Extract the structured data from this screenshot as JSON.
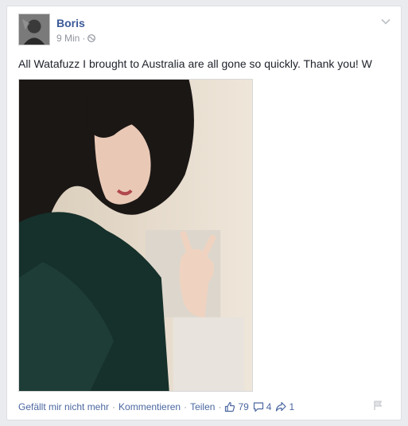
{
  "post": {
    "author": "Boris",
    "time": "9 Min",
    "dot": "·",
    "text": "All Watafuzz I brought to Australia are all gone so quickly. Thank you! W"
  },
  "actions": {
    "unlike": "Gefällt mir nicht mehr",
    "comment": "Kommentieren",
    "share": "Teilen",
    "separator": "·",
    "likes_count": "79",
    "comments_count": "4",
    "shares_count": "1"
  },
  "icons": {
    "audience": "globe-icon",
    "menu": "chevron-down-icon",
    "like": "thumbs-up-icon",
    "comment": "speech-bubble-icon",
    "share": "share-arrow-icon",
    "report": "flag-icon"
  },
  "colors": {
    "link": "#4b67a1",
    "author": "#3b5998",
    "meta": "#90949c",
    "text": "#1d2129"
  }
}
